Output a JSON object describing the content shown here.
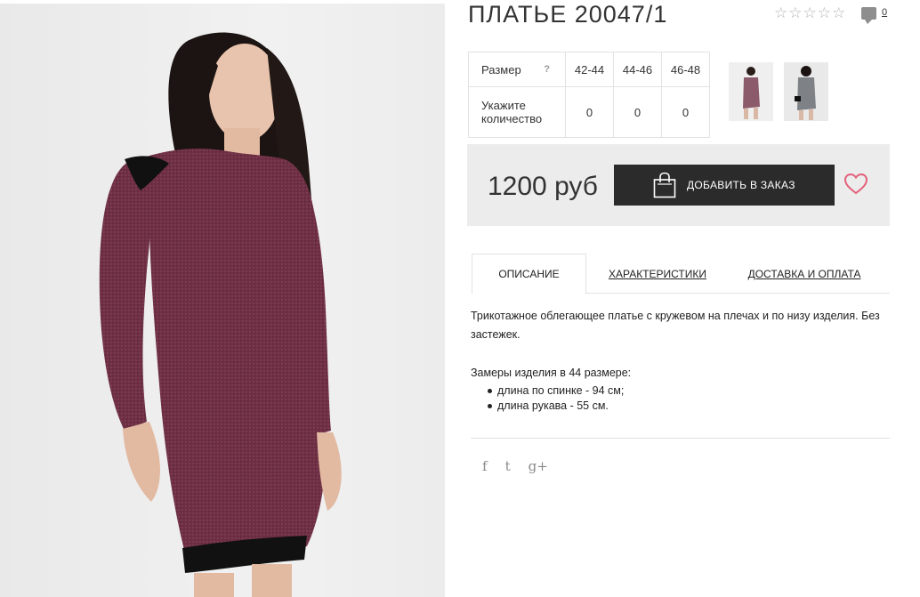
{
  "product": {
    "title": "ПЛАТЬЕ 20047/1",
    "rating_stars": 5,
    "comments_count": "0"
  },
  "sizes": {
    "header_label": "Размер",
    "help_mark": "?",
    "columns": [
      "42-44",
      "44-46",
      "46-48"
    ],
    "quantity_label": "Укажите количество",
    "quantities": [
      "0",
      "0",
      "0"
    ]
  },
  "price": {
    "amount": "1200 руб",
    "add_button": "ДОБАВИТЬ В ЗАКАЗ"
  },
  "tabs": [
    {
      "label": "ОПИСАНИЕ",
      "active": true
    },
    {
      "label": "ХАРАКТЕРИСТИКИ",
      "active": false
    },
    {
      "label": "ДОСТАВКА И ОПЛАТА",
      "active": false
    }
  ],
  "description": {
    "text": "Трикотажное облегающее платье с кружевом на плечах и по низу изделия. Без застежек.",
    "measures_title": "Замеры изделия в 44 размере:",
    "measures": [
      "длина по спинке - 94 см;",
      "длина рукава - 55 см."
    ]
  },
  "social": [
    "f",
    "t",
    "g+"
  ],
  "colors": {
    "dress": "#6e2f44",
    "button_bg": "#2b2b2b",
    "heart": "#e2617a",
    "price_box": "#ececec"
  },
  "icons": {
    "star": "star-outline-icon",
    "comment": "comment-icon",
    "bag": "shopping-bag-icon",
    "heart": "heart-outline-icon",
    "facebook": "facebook-icon",
    "twitter": "twitter-icon",
    "google_plus": "google-plus-icon"
  }
}
